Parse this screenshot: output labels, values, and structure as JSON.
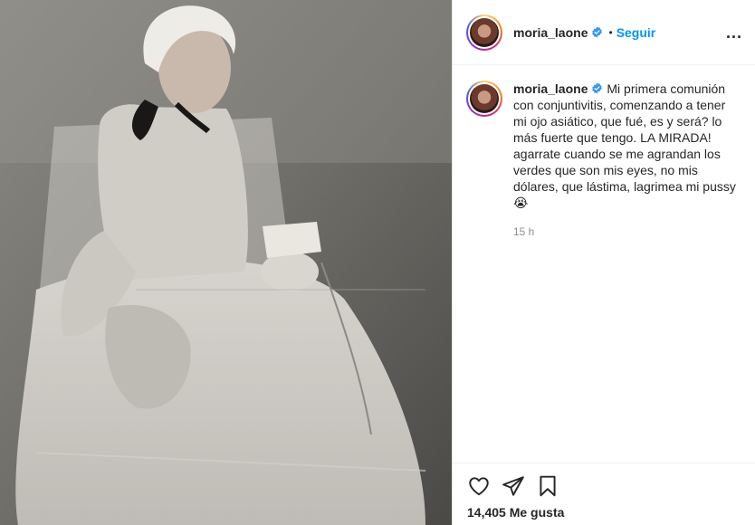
{
  "post": {
    "author": {
      "username": "moria_laone",
      "verified": true,
      "dot": "•",
      "follow_label": "Seguir"
    },
    "more_options_label": "...",
    "photo": {
      "description": "Vintage black and white photo of a girl in first communion dress holding a book and rosary"
    },
    "caption": {
      "username": "moria_laone",
      "text": "Mi primera comunión con conjuntivitis, comenzando a tener mi ojo asiático, que fué, es y será? lo más fuerte que tengo. LA MIRADA! agarrate cuando se me agrandan los verdes que son mis eyes, no mis dólares, que lástima, lagrimea mi pussy 😭",
      "time": "15 h"
    },
    "actions": {
      "like_icon": "heart-icon",
      "share_icon": "paper-plane-icon",
      "save_icon": "bookmark-icon",
      "likes_count": "14,405",
      "likes_label": "Me gusta"
    },
    "colors": {
      "accent": "#0095f6",
      "verified_badge": "#3897f0"
    }
  }
}
